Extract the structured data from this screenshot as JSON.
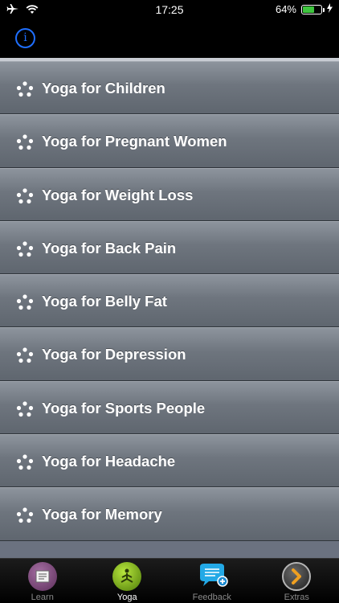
{
  "status_bar": {
    "time": "17:25",
    "battery_percent": "64%",
    "battery_level": 0.64,
    "icons": [
      "airplane-icon",
      "wifi-icon",
      "battery-icon",
      "charging-bolt-icon"
    ]
  },
  "nav": {
    "info_label": "i"
  },
  "list": {
    "items": [
      {
        "label": "Yoga for Children"
      },
      {
        "label": "Yoga for Pregnant Women"
      },
      {
        "label": "Yoga for Weight Loss"
      },
      {
        "label": "Yoga for Back Pain"
      },
      {
        "label": "Yoga for Belly Fat"
      },
      {
        "label": "Yoga for Depression"
      },
      {
        "label": "Yoga for Sports People"
      },
      {
        "label": "Yoga for Headache"
      },
      {
        "label": "Yoga for Memory"
      }
    ]
  },
  "tab_bar": {
    "tabs": [
      {
        "label": "Learn",
        "icon": "learn-icon",
        "active": false
      },
      {
        "label": "Yoga",
        "icon": "yoga-icon",
        "active": true
      },
      {
        "label": "Feedback",
        "icon": "feedback-icon",
        "active": false
      },
      {
        "label": "Extras",
        "icon": "extras-icon",
        "active": false
      }
    ]
  },
  "colors": {
    "info_blue": "#1f6fff",
    "battery_green": "#3ec53e",
    "row_top": "#8d949d",
    "row_bottom": "#5f666f"
  }
}
